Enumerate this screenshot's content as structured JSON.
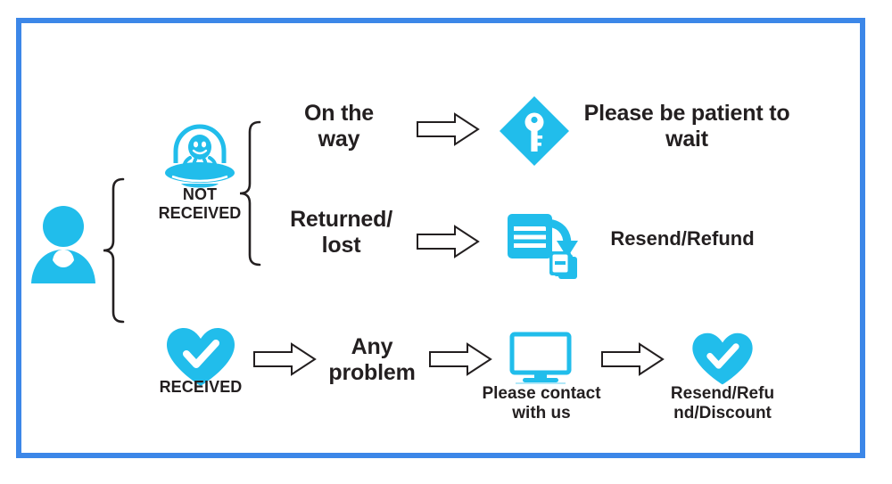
{
  "diagram": {
    "title_text": "",
    "colors": {
      "frame_blue": "#3c87e8",
      "icon_cyan": "#21bdeb",
      "text_dark": "#231f20",
      "arrow_outline": "#231f20",
      "background": "#ffffff"
    },
    "root": {
      "icon_name": "customer-person-icon",
      "label": ""
    },
    "branches": [
      {
        "id": "not-received",
        "icon_name": "ufo-alien-icon",
        "label": "NOT\nRECEIVED",
        "sub_branches": [
          {
            "id": "on-the-way",
            "label": "On the\nway",
            "arrow_name": "arrow-right-outline-icon",
            "outcome_icon_name": "key-diamond-icon",
            "outcome_label": "Please be patient to\nwait"
          },
          {
            "id": "returned-lost",
            "label": "Returned/\nlost",
            "arrow_name": "arrow-right-outline-icon",
            "outcome_icon_name": "document-resend-icon",
            "outcome_label": "Resend/Refund"
          }
        ]
      },
      {
        "id": "received",
        "icon_name": "heart-check-icon",
        "label": "RECEIVED",
        "steps": [
          {
            "id": "any-problem",
            "arrow_name": "arrow-right-outline-icon",
            "label": "Any\nproblem"
          },
          {
            "id": "contact-us",
            "arrow_name": "arrow-right-outline-icon",
            "icon_name": "monitor-icon",
            "label": "Please contact\nwith us"
          },
          {
            "id": "resend-refund-discount",
            "arrow_name": "arrow-right-outline-icon",
            "icon_name": "heart-check-icon",
            "label": "Resend/Refu\nnd/Discount"
          }
        ]
      }
    ],
    "braces": [
      {
        "id": "root-brace",
        "name": "outer-brace"
      },
      {
        "id": "not-received-brace",
        "name": "inner-brace"
      }
    ]
  }
}
